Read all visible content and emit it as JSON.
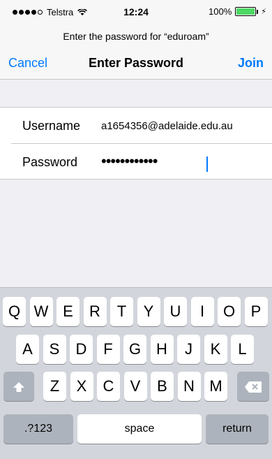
{
  "status": {
    "carrier": "Telstra",
    "time": "12:24",
    "battery": "100%",
    "battery_level": 1.0,
    "signal_bars_filled": 4,
    "signal_bars_total": 5
  },
  "prompt": "Enter the password for “eduroam”",
  "nav": {
    "cancel": "Cancel",
    "title": "Enter Password",
    "join": "Join"
  },
  "form": {
    "username_label": "Username",
    "username_value": "a1654356@adelaide.edu.au",
    "password_label": "Password",
    "password_mask": "••••••••••••"
  },
  "keyboard": {
    "row1": [
      "Q",
      "W",
      "E",
      "R",
      "T",
      "Y",
      "U",
      "I",
      "O",
      "P"
    ],
    "row2": [
      "A",
      "S",
      "D",
      "F",
      "G",
      "H",
      "J",
      "K",
      "L"
    ],
    "row3": [
      "Z",
      "X",
      "C",
      "V",
      "B",
      "N",
      "M"
    ],
    "numbers": ".?123",
    "space": "space",
    "return": "return"
  },
  "colors": {
    "accent": "#007aff",
    "battery": "#4cd964",
    "keyboard_bg": "#d2d5db"
  },
  "icons": [
    "wifi-icon",
    "battery-icon",
    "bolt-icon",
    "shift-icon",
    "delete-icon"
  ]
}
